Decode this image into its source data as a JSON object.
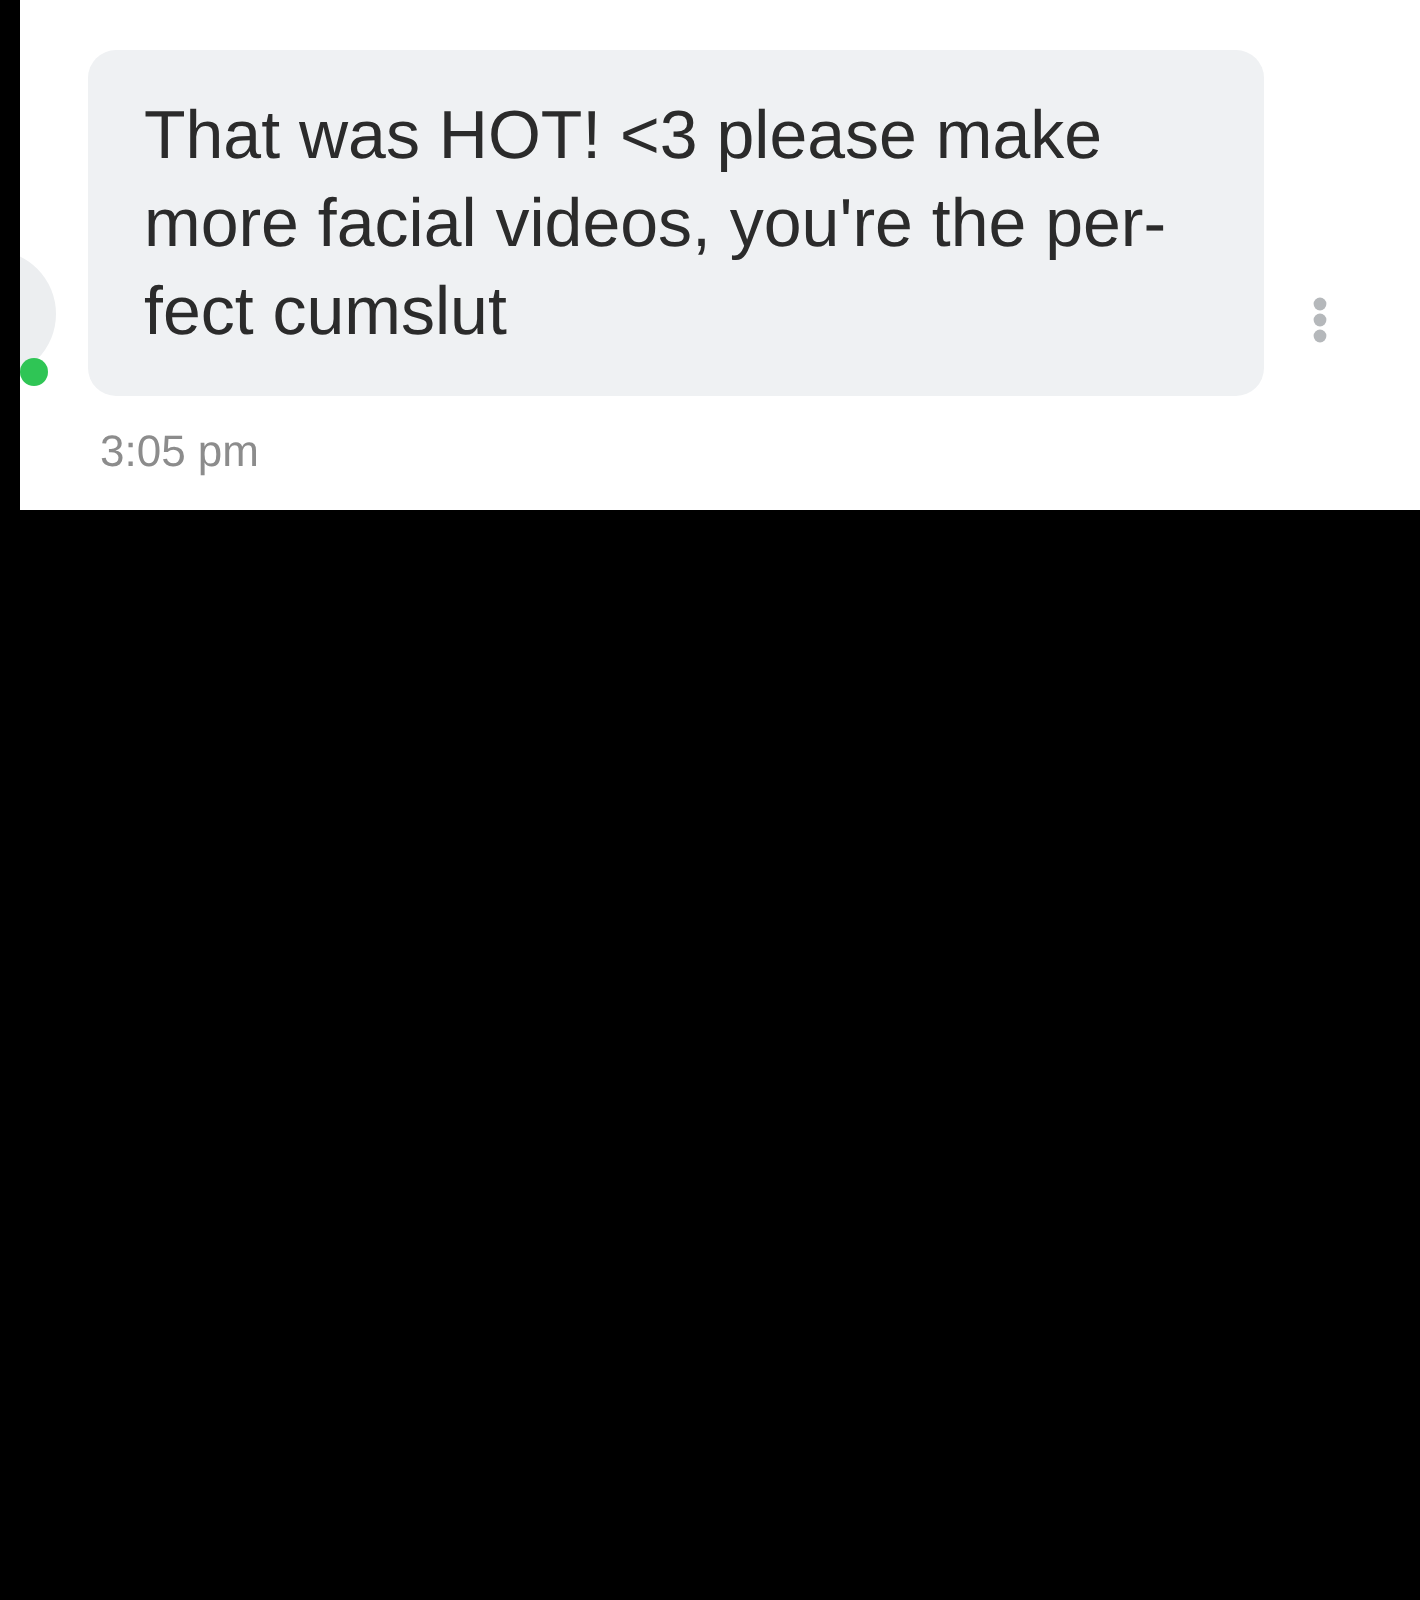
{
  "sender": {
    "online": true
  },
  "message": {
    "lines": [
      "That was HOT! <3 please make",
      "more facial videos, you're the per-",
      "fect cumslut"
    ],
    "time": "3:05 pm"
  }
}
